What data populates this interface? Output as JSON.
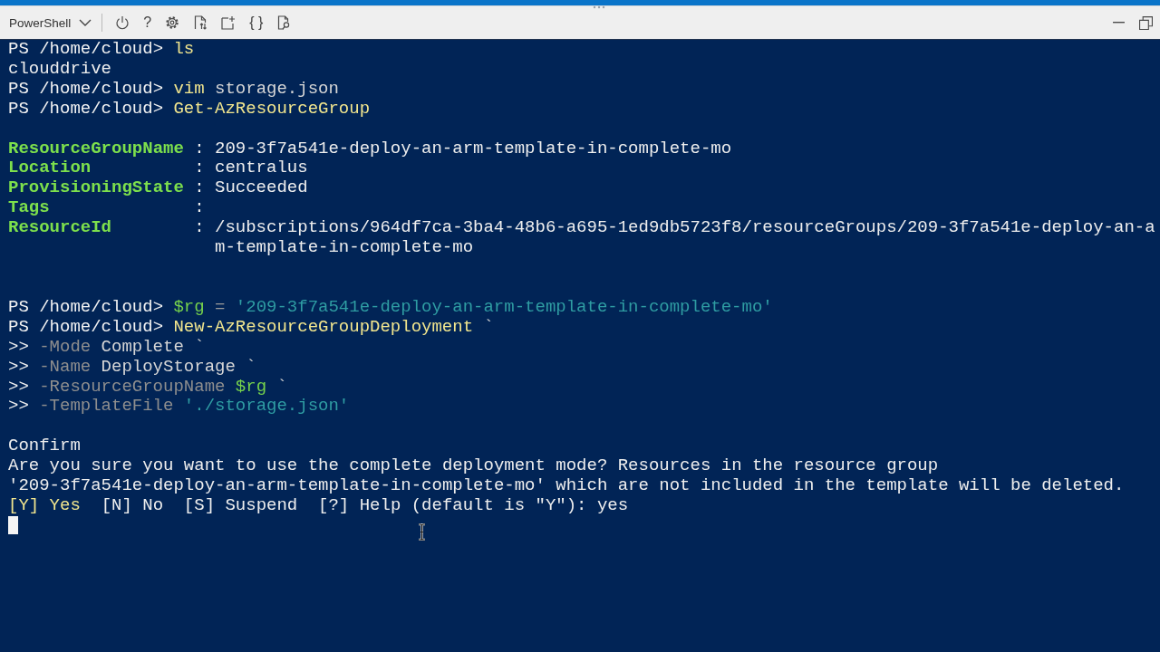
{
  "toolbar": {
    "shell_selector": "PowerShell",
    "help_label": "?",
    "braces_label": "{ }"
  },
  "terminal": {
    "lines": [
      {
        "kind": "text",
        "segments": [
          {
            "kind": "prompt",
            "text": "PS /home/cloud>"
          },
          {
            "kind": "command",
            "text": "ls"
          }
        ]
      },
      {
        "kind": "text",
        "segments": [
          {
            "kind": "output",
            "text": "clouddrive"
          }
        ]
      },
      {
        "kind": "text",
        "segments": [
          {
            "kind": "prompt",
            "text": "PS /home/cloud>"
          },
          {
            "kind": "command",
            "text": "vim"
          },
          {
            "kind": "argument",
            "text": "storage.json"
          }
        ]
      },
      {
        "kind": "text",
        "segments": [
          {
            "kind": "prompt",
            "text": "PS /home/cloud>"
          },
          {
            "kind": "command",
            "text": "Get-AzResourceGroup"
          }
        ]
      },
      {
        "kind": "blank"
      },
      {
        "kind": "property",
        "name": "ResourceGroupName",
        "separator": ":",
        "value": "209-3f7a541e-deploy-an-arm-template-in-complete-mo"
      },
      {
        "kind": "property",
        "name": "Location",
        "separator": ":",
        "value": "centralus"
      },
      {
        "kind": "property",
        "name": "ProvisioningState",
        "separator": ":",
        "value": "Succeeded"
      },
      {
        "kind": "property",
        "name": "Tags",
        "separator": ":"
      },
      {
        "kind": "property",
        "name": "ResourceId",
        "separator": ":",
        "value": "/subscriptions/964df7ca-3ba4-48b6-a695-1ed9db5723f8/resourceGroups/209-3f7a541e-deploy-an-a",
        "value_wrapped": "m-template-in-complete-mo"
      },
      {
        "kind": "blank"
      },
      {
        "kind": "blank"
      },
      {
        "kind": "text",
        "segments": [
          {
            "kind": "prompt",
            "text": "PS /home/cloud>"
          },
          {
            "kind": "variable",
            "text": "$rg"
          },
          {
            "kind": "operator",
            "text": "="
          },
          {
            "kind": "string",
            "text": "'209-3f7a541e-deploy-an-arm-template-in-complete-mo'"
          }
        ]
      },
      {
        "kind": "text",
        "segments": [
          {
            "kind": "prompt",
            "text": "PS /home/cloud>"
          },
          {
            "kind": "command",
            "text": "New-AzResourceGroupDeployment"
          },
          {
            "kind": "escape",
            "text": "`"
          }
        ]
      },
      {
        "kind": "text",
        "segments": [
          {
            "kind": "prompt",
            "text": ">>"
          },
          {
            "kind": "parameter",
            "text": "-Mode"
          },
          {
            "kind": "argument",
            "text": "Complete"
          },
          {
            "kind": "escape",
            "text": "`"
          }
        ]
      },
      {
        "kind": "text",
        "segments": [
          {
            "kind": "prompt",
            "text": ">>"
          },
          {
            "kind": "parameter",
            "text": "-Name"
          },
          {
            "kind": "argument",
            "text": "DeployStorage"
          },
          {
            "kind": "escape",
            "text": "`"
          }
        ]
      },
      {
        "kind": "text",
        "segments": [
          {
            "kind": "prompt",
            "text": ">>"
          },
          {
            "kind": "parameter",
            "text": "-ResourceGroupName"
          },
          {
            "kind": "variable",
            "text": "$rg"
          },
          {
            "kind": "escape",
            "text": "`"
          }
        ]
      },
      {
        "kind": "text",
        "segments": [
          {
            "kind": "prompt",
            "text": ">>"
          },
          {
            "kind": "parameter",
            "text": "-TemplateFile"
          },
          {
            "kind": "string",
            "text": "'./storage.json'"
          }
        ]
      },
      {
        "kind": "blank"
      },
      {
        "kind": "text",
        "segments": [
          {
            "kind": "output",
            "text": "Confirm"
          }
        ]
      },
      {
        "kind": "text",
        "segments": [
          {
            "kind": "output",
            "text": "Are you sure you want to use the complete deployment mode? Resources in the resource group"
          }
        ]
      },
      {
        "kind": "text",
        "segments": [
          {
            "kind": "output",
            "text": "'209-3f7a541e-deploy-an-arm-template-in-complete-mo' which are not included in the template will be deleted."
          }
        ]
      },
      {
        "kind": "text",
        "segments": [
          {
            "kind": "default-choice",
            "text": "[Y] Yes"
          },
          {
            "kind": "choice",
            "text": "[N] No"
          },
          {
            "kind": "choice",
            "text": "[S] Suspend"
          },
          {
            "kind": "help",
            "text": "[?] Help (default is \"Y\"):"
          },
          {
            "kind": "answer",
            "text": "yes"
          }
        ]
      },
      {
        "kind": "cursor"
      }
    ]
  }
}
